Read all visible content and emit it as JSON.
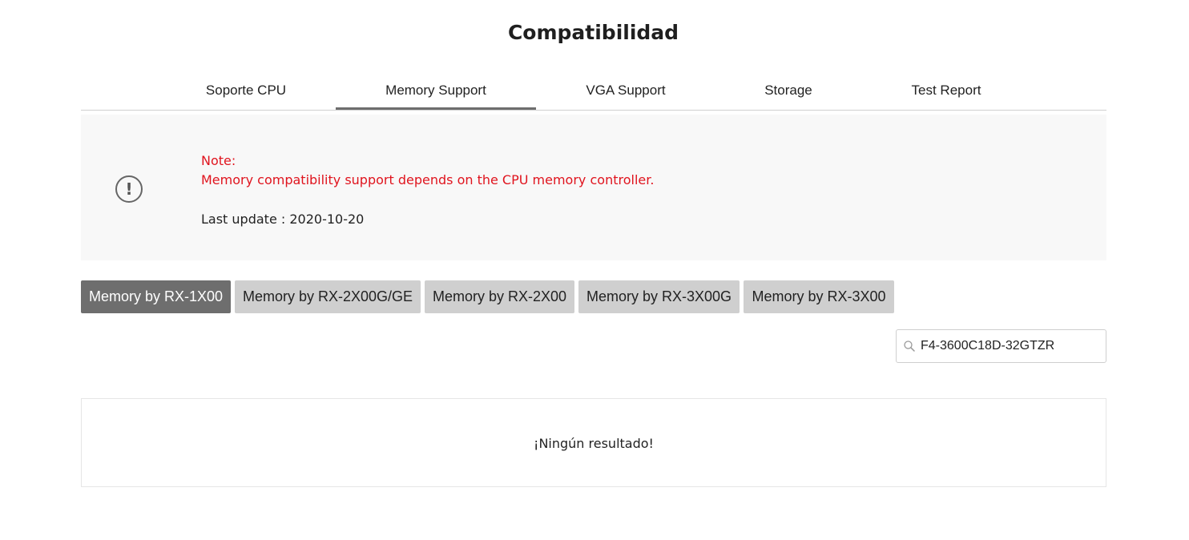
{
  "page": {
    "title": "Compatibilidad"
  },
  "tabs": [
    {
      "label": "Soporte CPU",
      "active": false
    },
    {
      "label": "Memory Support",
      "active": true
    },
    {
      "label": "VGA Support",
      "active": false
    },
    {
      "label": "Storage",
      "active": false
    },
    {
      "label": "Test Report",
      "active": false
    }
  ],
  "note": {
    "icon": "exclamation-circle-icon",
    "heading": "Note:",
    "message": "Memory compatibility support depends on the CPU memory controller.",
    "last_update": "Last update : 2020-10-20",
    "accent_color": "#e0141e"
  },
  "memory_tabs": [
    {
      "label": "Memory by RX-1X00",
      "active": true
    },
    {
      "label": "Memory by RX-2X00G/GE",
      "active": false
    },
    {
      "label": "Memory by RX-2X00",
      "active": false
    },
    {
      "label": "Memory by RX-3X00G",
      "active": false
    },
    {
      "label": "Memory by RX-3X00",
      "active": false
    }
  ],
  "search": {
    "icon": "search-icon",
    "value": "F4-3600C18D-32GTZR"
  },
  "results": {
    "empty_message": "¡Ningún resultado!"
  },
  "colors": {
    "active_tab": "#6e6e6e",
    "inactive_tab": "#cfcfcf",
    "note_background": "#f8f8f8"
  }
}
